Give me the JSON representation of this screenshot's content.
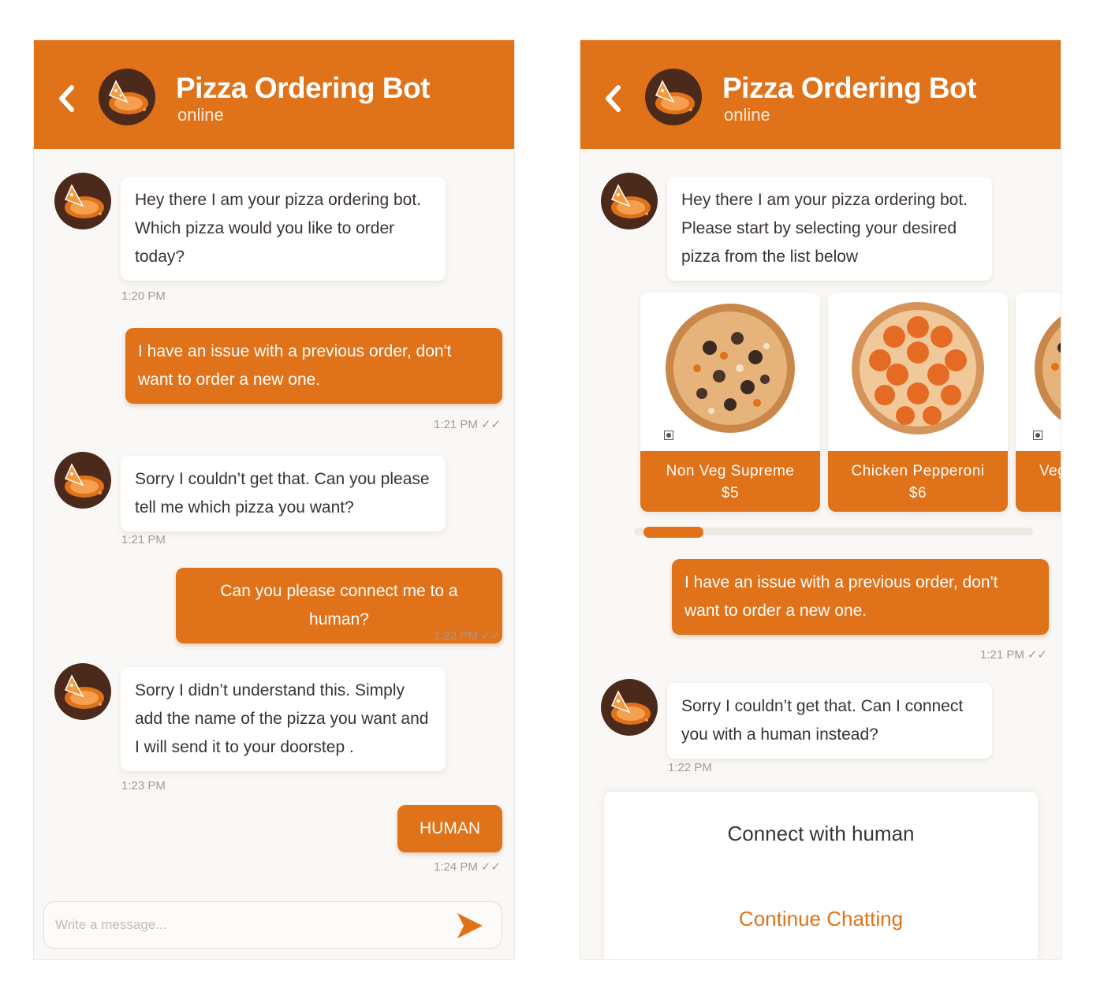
{
  "left": {
    "header": {
      "title": "Pizza Ordering Bot",
      "status": "online"
    },
    "messages": [
      {
        "text": "Hey there I am your pizza ordering bot. Which pizza would you like to order today?",
        "time": "1:20 PM"
      },
      {
        "text": "I have an issue with a previous order, don't want to order a new one.",
        "time": "1:21 PM"
      },
      {
        "text": "Sorry I couldn’t get that. Can you please tell me which pizza you want?",
        "time": "1:21 PM"
      },
      {
        "text": "Can you please connect me to a human?",
        "time": "1:22 PM"
      },
      {
        "text": "Sorry I didn’t understand this. Simply add the name of the pizza you want and I will send it to your doorstep .",
        "time": "1:23 PM"
      },
      {
        "text": "HUMAN",
        "time": "1:24 PM"
      }
    ],
    "composer": {
      "placeholder": "Write a message..."
    }
  },
  "right": {
    "header": {
      "title": "Pizza Ordering Bot",
      "status": "online"
    },
    "messages": [
      {
        "text": "Hey there I am your pizza ordering bot. Please start by selecting your desired pizza from the list below"
      },
      {
        "text": "I have an issue with a previous order, don't want to order a new one.",
        "time": "1:21 PM"
      },
      {
        "text": "Sorry I couldn’t get that. Can I connect you with a human instead?",
        "time": "1:22 PM"
      }
    ],
    "pizzas": [
      {
        "name": "Non Veg Supreme",
        "price": "$5"
      },
      {
        "name": "Chicken Pepperoni",
        "price": "$6"
      },
      {
        "name": "Veg",
        "price": ""
      }
    ],
    "carousel_scroll_fraction": 0.15,
    "options": {
      "primary": "Connect with human",
      "secondary": "Continue Chatting"
    }
  },
  "colors": {
    "brand": "#e07219",
    "avatar_bg": "#4b2a1c",
    "background": "#faf8f6"
  }
}
